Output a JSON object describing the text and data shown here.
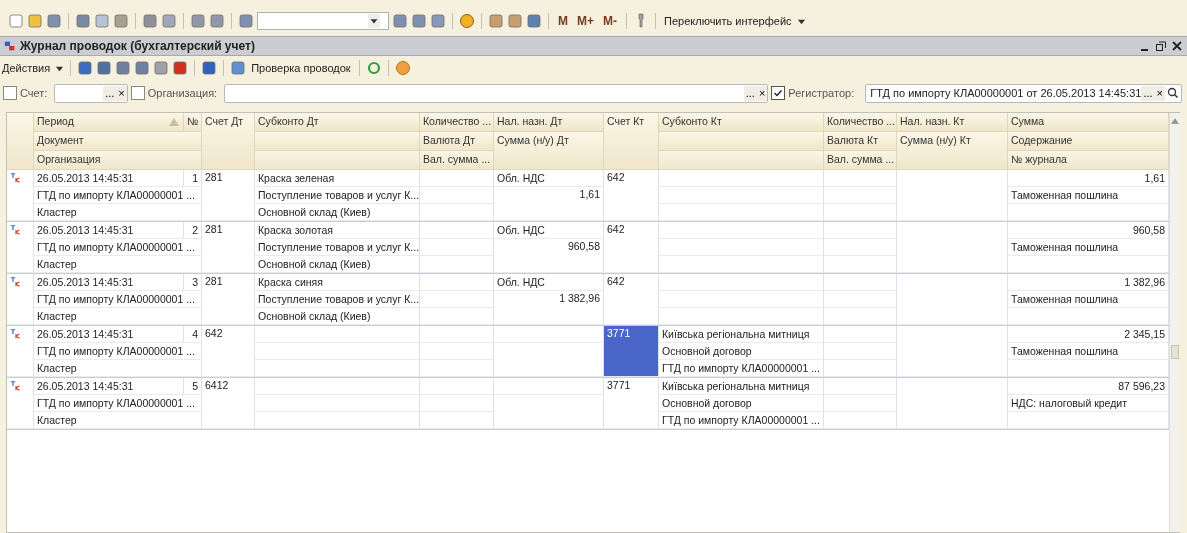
{
  "toolbar": {
    "memory_buttons": [
      "M",
      "M+",
      "M-"
    ],
    "interface_switch": "Переключить интерфейс"
  },
  "window": {
    "title": "Журнал проводок (бухгалтерский учет)"
  },
  "actions": {
    "menu": "Действия",
    "check_button": "Проверка проводок"
  },
  "filters": [
    {
      "label": "Счет:",
      "checked": false,
      "choose": "...",
      "clear": "×"
    },
    {
      "label": "Организация:",
      "checked": false,
      "choose": "...",
      "clear": "×"
    },
    {
      "label": "Регистратор:",
      "checked": true,
      "value": "ГТД по импорту КЛА00000001 от 26.05.2013 14:45:31",
      "choose": "...",
      "clear": "×"
    }
  ],
  "table": {
    "header": {
      "period": "Период",
      "num": "№",
      "document": "Документ",
      "organization": "Организация",
      "acct_dt": "Счет Дт",
      "subconto_dt": "Субконто Дт",
      "qty_dt": "Количество ...",
      "currency_dt": "Валюта Дт",
      "cur_sum_dt": "Вал. сумма ...",
      "tax_dt": "Нал. назн. Дт",
      "sum_tax_dt": "Сумма (н/у) Дт",
      "acct_kt": "Счет Кт",
      "subconto_kt": "Субконто Кт",
      "qty_kt": "Количество ...",
      "currency_kt": "Валюта Кт",
      "cur_sum_kt": "Вал. сумма ...",
      "tax_kt": "Нал. назн. Кт",
      "sum_tax_kt": "Сумма (н/у) Кт",
      "sum": "Сумма",
      "content": "Содержание",
      "journal": "№ журнала"
    },
    "rows": [
      {
        "period": "26.05.2013 14:45:31",
        "num": "1",
        "document": "ГТД по импорту КЛА00000001 ...",
        "organization": "Кластер",
        "acct_dt": "281",
        "subconto_dt": [
          "Краска зеленая",
          "Поступление товаров и услуг К...",
          "Основной склад (Киев)"
        ],
        "tax_dt": "Обл. НДС",
        "sum_tax_dt": "1,61",
        "acct_kt": "642",
        "subconto_kt": [],
        "sum": "1,61",
        "content": "Таможенная пошлина",
        "selected": false
      },
      {
        "period": "26.05.2013 14:45:31",
        "num": "2",
        "document": "ГТД по импорту КЛА00000001 ...",
        "organization": "Кластер",
        "acct_dt": "281",
        "subconto_dt": [
          "Краска золотая",
          "Поступление товаров и услуг К...",
          "Основной склад (Киев)"
        ],
        "tax_dt": "Обл. НДС",
        "sum_tax_dt": "960,58",
        "acct_kt": "642",
        "subconto_kt": [],
        "sum": "960,58",
        "content": "Таможенная пошлина",
        "selected": false
      },
      {
        "period": "26.05.2013 14:45:31",
        "num": "3",
        "document": "ГТД по импорту КЛА00000001 ...",
        "organization": "Кластер",
        "acct_dt": "281",
        "subconto_dt": [
          "Краска синяя",
          "Поступление товаров и услуг К...",
          "Основной склад (Киев)"
        ],
        "tax_dt": "Обл. НДС",
        "sum_tax_dt": "1 382,96",
        "acct_kt": "642",
        "subconto_kt": [],
        "sum": "1 382,96",
        "content": "Таможенная пошлина",
        "selected": false
      },
      {
        "period": "26.05.2013 14:45:31",
        "num": "4",
        "document": "ГТД по импорту КЛА00000001 ...",
        "organization": "Кластер",
        "acct_dt": "642",
        "subconto_dt": [],
        "acct_kt": "3771",
        "subconto_kt": [
          "Київська регіональна митниця",
          "Основной договор",
          "ГТД по импорту КЛА00000001 ..."
        ],
        "sum": "2 345,15",
        "content": "Таможенная пошлина",
        "selected": true
      },
      {
        "period": "26.05.2013 14:45:31",
        "num": "5",
        "document": "ГТД по импорту КЛА00000001 ...",
        "organization": "Кластер",
        "acct_dt": "6412",
        "subconto_dt": [],
        "acct_kt": "3771",
        "subconto_kt": [
          "Київська регіональна митниця",
          "Основной договор",
          "ГТД по импорту КЛА00000001 ..."
        ],
        "sum": "87 596,23",
        "content": "НДС: налоговый кредит",
        "selected": false
      }
    ]
  }
}
